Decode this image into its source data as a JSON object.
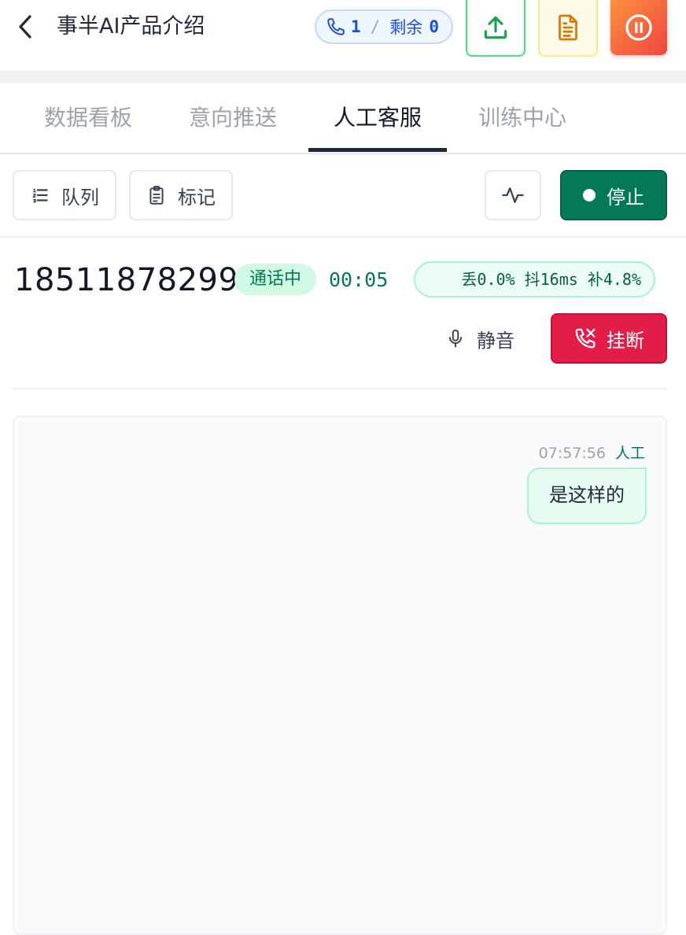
{
  "header": {
    "title": "事半AI产品介绍",
    "active_calls": "1",
    "separator": "/",
    "remaining_label": "剩余",
    "remaining_value": "0"
  },
  "tabs": [
    {
      "label": "数据看板",
      "active": false
    },
    {
      "label": "意向推送",
      "active": false
    },
    {
      "label": "人工客服",
      "active": true
    },
    {
      "label": "训练中心",
      "active": false
    }
  ],
  "toolbar": {
    "queue_label": "队列",
    "mark_label": "标记",
    "stop_label": "停止"
  },
  "call": {
    "phone_number": "18511878299",
    "status": "通话中",
    "duration": "00:05",
    "stats": "丢0.0% 抖16ms 补4.8%",
    "mute_label": "静音",
    "hangup_label": "挂断"
  },
  "chat": {
    "messages": [
      {
        "time": "07:57:56",
        "sender": "人工",
        "text": "是这样的"
      }
    ]
  },
  "colors": {
    "accent_green": "#047857",
    "hangup_red": "#e11d48",
    "call_pill_blue": "#1d4ed8",
    "pause_gradient_start": "#fb923c",
    "pause_gradient_end": "#ef4444"
  },
  "icons": {
    "back": "chevron-left-icon",
    "phone": "phone-icon",
    "upload": "upload-icon",
    "document": "document-icon",
    "pause": "pause-circle-icon",
    "queue": "list-icon",
    "mark": "clipboard-icon",
    "waveform": "activity-icon",
    "mic": "microphone-icon",
    "hangup": "phone-off-icon"
  }
}
